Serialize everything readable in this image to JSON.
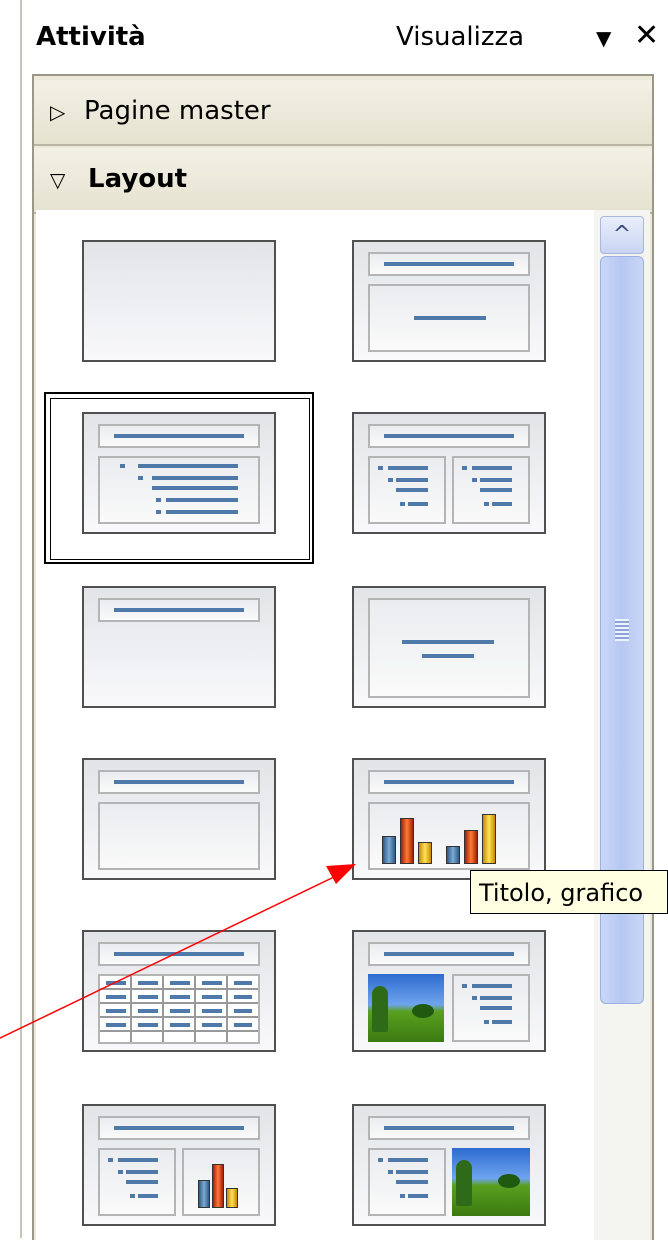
{
  "header": {
    "title": "Attività",
    "view_label": "Visualizza"
  },
  "sections": [
    {
      "label": "Pagine master",
      "expanded": false
    },
    {
      "label": "Layout",
      "expanded": true
    }
  ],
  "layouts": [
    "blank",
    "title-content",
    "title-bulleted-text",
    "title-two-columns",
    "title-only",
    "centered-text",
    "title-object",
    "title-chart",
    "title-table",
    "title-image-text",
    "title-text-chart",
    "title-text-image"
  ],
  "selected_layout": 2,
  "tooltip": {
    "text": "Titolo, grafico"
  },
  "colors": {
    "accent": "#4f79a8",
    "panel": "#ece9d8",
    "tooltip_bg": "#ffffe1",
    "arrow": "#ff0000"
  }
}
